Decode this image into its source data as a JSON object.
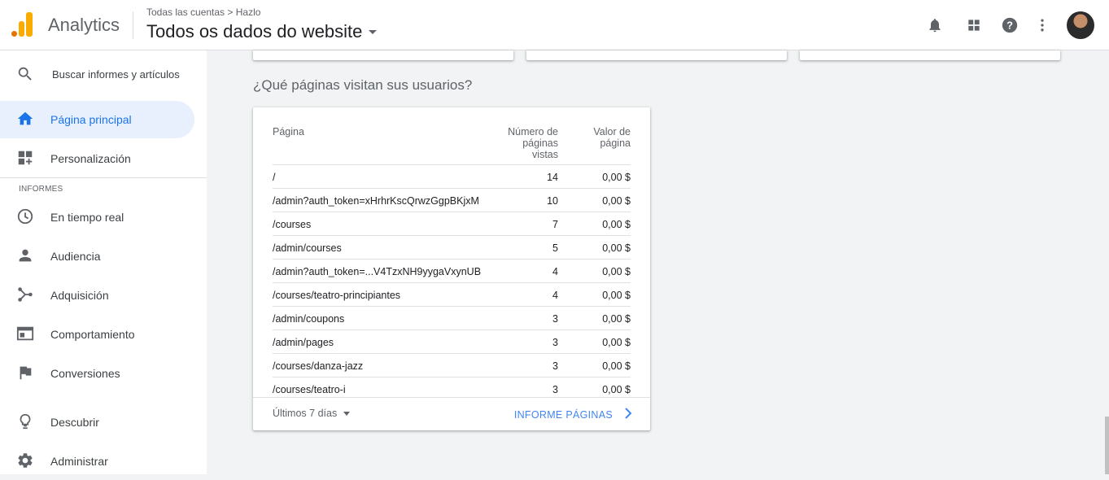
{
  "header": {
    "app_name": "Analytics",
    "breadcrumb": "Todas las cuentas > Hazlo",
    "view_title": "Todos os dados do website"
  },
  "sidebar": {
    "search_label": "Buscar informes y artículos",
    "items_top": [
      {
        "label": "Página principal",
        "icon": "home-icon",
        "active": true
      },
      {
        "label": "Personalización",
        "icon": "dashboard-customize-icon",
        "active": false
      }
    ],
    "section_label": "INFORMES",
    "report_items": [
      {
        "label": "En tiempo real",
        "icon": "clock-icon"
      },
      {
        "label": "Audiencia",
        "icon": "person-icon"
      },
      {
        "label": "Adquisición",
        "icon": "acquisition-icon"
      },
      {
        "label": "Comportamiento",
        "icon": "behavior-icon"
      },
      {
        "label": "Conversiones",
        "icon": "flag-icon"
      }
    ],
    "bottom_items": [
      {
        "label": "Descubrir",
        "icon": "lightbulb-icon"
      },
      {
        "label": "Administrar",
        "icon": "gear-icon"
      }
    ]
  },
  "main": {
    "section_title": "¿Qué páginas visitan sus usuarios?",
    "table": {
      "headers": {
        "page": "Página",
        "views_1": "Número de",
        "views_2": "páginas",
        "views_3": "vistas",
        "value_1": "Valor de",
        "value_2": "página"
      },
      "rows": [
        {
          "page": "/",
          "views": "14",
          "value": "0,00 $"
        },
        {
          "page": "/admin?auth_token=xHrhrKscQrwzGgpBKjxM",
          "views": "10",
          "value": "0,00 $"
        },
        {
          "page": "/courses",
          "views": "7",
          "value": "0,00 $"
        },
        {
          "page": "/admin/courses",
          "views": "5",
          "value": "0,00 $"
        },
        {
          "page": "/admin?auth_token=...V4TzxNH9yygaVxynUB",
          "views": "4",
          "value": "0,00 $"
        },
        {
          "page": "/courses/teatro-principiantes",
          "views": "4",
          "value": "0,00 $"
        },
        {
          "page": "/admin/coupons",
          "views": "3",
          "value": "0,00 $"
        },
        {
          "page": "/admin/pages",
          "views": "3",
          "value": "0,00 $"
        },
        {
          "page": "/courses/danza-jazz",
          "views": "3",
          "value": "0,00 $"
        },
        {
          "page": "/courses/teatro-i",
          "views": "3",
          "value": "0,00 $"
        }
      ]
    },
    "footer": {
      "period": "Últimos 7 días",
      "report_link": "INFORME PÁGINAS"
    }
  },
  "colors": {
    "accent": "#1a73e8",
    "active_bg": "#e8f0fe",
    "logo_orange": "#e37400",
    "logo_yellow": "#f9ab00"
  }
}
